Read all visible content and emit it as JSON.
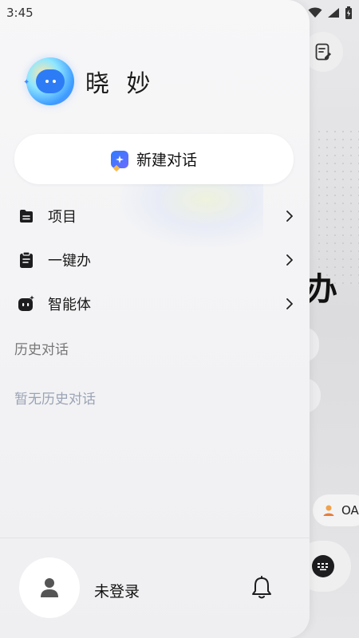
{
  "status_bar": {
    "time": "3:45",
    "icons": [
      "wifi-icon",
      "signal-icon",
      "battery-icon"
    ]
  },
  "background_screen": {
    "edit_icon": "edit-note-icon",
    "partial_heading_char": "办",
    "chip_label": "OA",
    "chip_icon": "person-icon",
    "keyboard_icon": "keyboard-icon"
  },
  "drawer": {
    "brand": {
      "name": "晓 妙",
      "logo_icon": "chat-bubble-logo-icon"
    },
    "new_chat": {
      "label": "新建对话",
      "icon": "new-chat-icon"
    },
    "menu": [
      {
        "label": "项目",
        "icon": "folder-icon"
      },
      {
        "label": "一键办",
        "icon": "clipboard-icon"
      },
      {
        "label": "智能体",
        "icon": "robot-icon"
      }
    ],
    "history": {
      "title": "历史对话",
      "empty_text": "暂无历史对话"
    },
    "footer": {
      "user_label": "未登录",
      "avatar_icon": "user-icon",
      "notification_icon": "bell-icon"
    }
  },
  "colors": {
    "drawer_bg": "#f5f5f7",
    "accent_blue": "#2e7bff",
    "muted_text": "#777777",
    "empty_text": "#9aa3b5"
  }
}
